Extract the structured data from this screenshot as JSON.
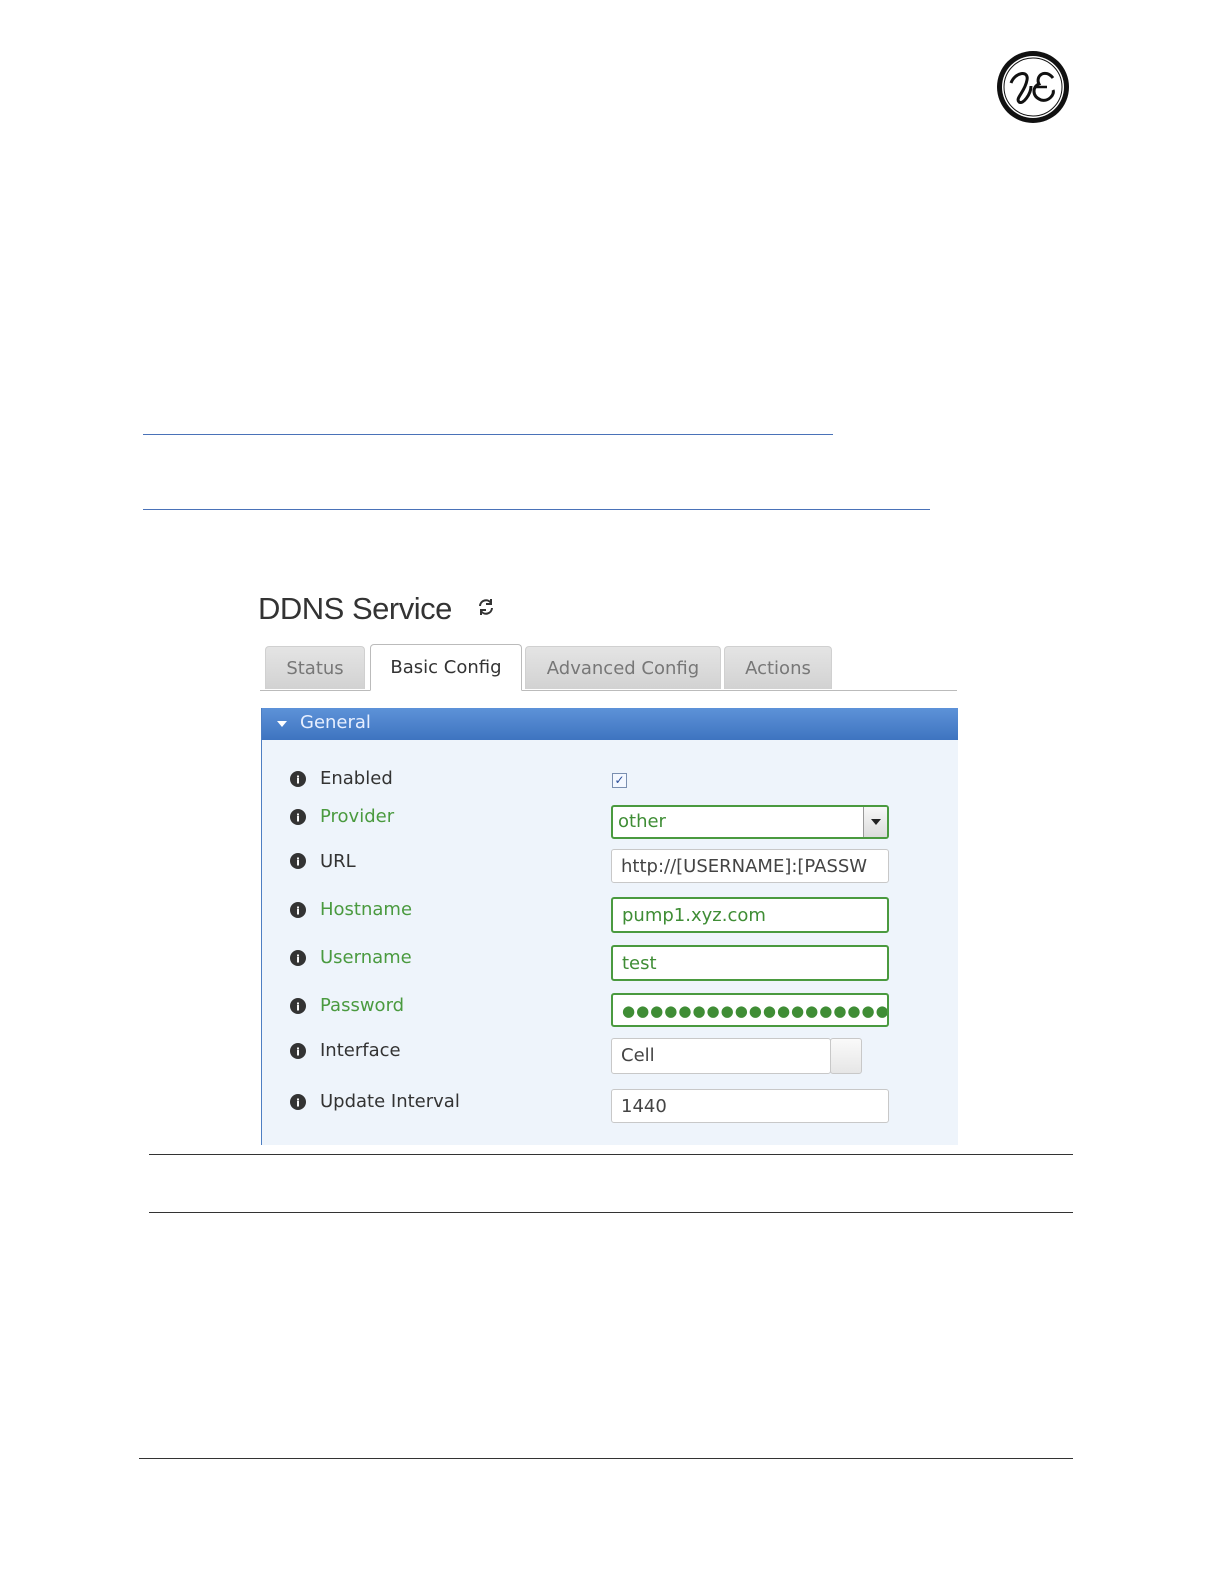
{
  "page": {
    "logo_text": "GE"
  },
  "screen": {
    "title": "DDNS Service",
    "tabs": [
      {
        "label": "Status",
        "active": false
      },
      {
        "label": "Basic Config",
        "active": true
      },
      {
        "label": "Advanced Config",
        "active": false
      },
      {
        "label": "Actions",
        "active": false
      }
    ],
    "section": {
      "title": "General",
      "fields": {
        "enabled": {
          "label": "Enabled",
          "checked": true,
          "check_mark": "✓"
        },
        "provider": {
          "label": "Provider",
          "value": "other"
        },
        "url": {
          "label": "URL",
          "value": "http://[USERNAME]:[PASSW"
        },
        "hostname": {
          "label": "Hostname",
          "value": "pump1.xyz.com"
        },
        "username": {
          "label": "Username",
          "value": "test"
        },
        "password": {
          "label": "Password",
          "value": "●●●●●●●●●●●●●●●●●●●●●●●●●"
        },
        "interface": {
          "label": "Interface",
          "value": "Cell"
        },
        "update_interval": {
          "label": "Update Interval",
          "value": "1440"
        }
      }
    }
  },
  "colors": {
    "link": "#4a72b8",
    "section_header": "#4d82cc",
    "changed_field": "#4a9a3f"
  }
}
